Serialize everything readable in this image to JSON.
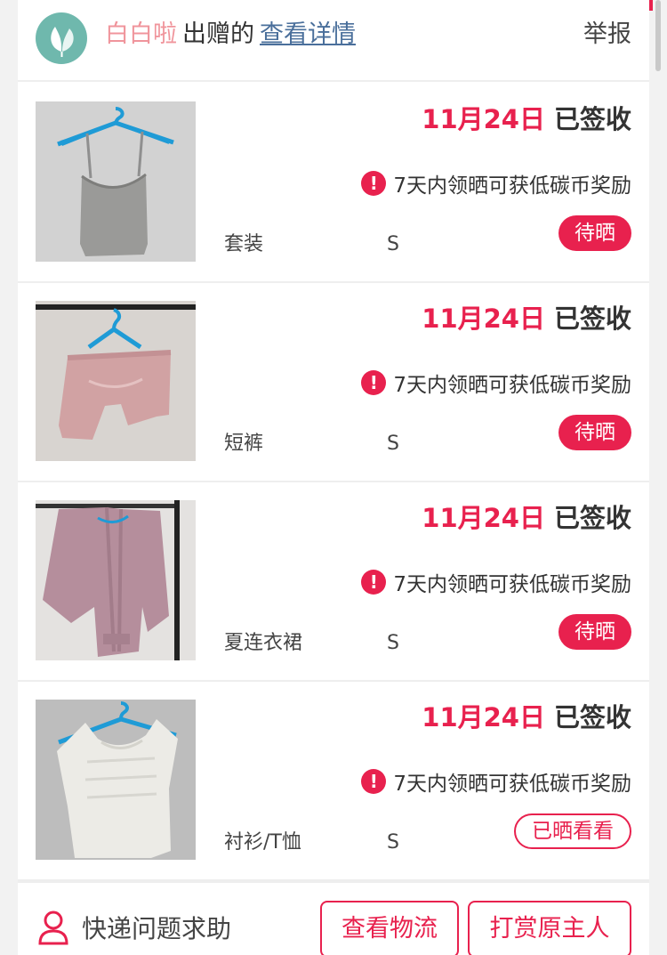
{
  "header": {
    "giver_name": "白白啦",
    "gave_text": "出赠的",
    "details_link": "查看详情",
    "report_label": "举报"
  },
  "items": [
    {
      "date": "11月24日",
      "status": "已签收",
      "hint": "7天内领晒可获低碳币奖励",
      "category": "套装",
      "size": "S",
      "action_label": "待晒",
      "action_style": "filled",
      "image": "grey-camisole-on-blue-hanger"
    },
    {
      "date": "11月24日",
      "status": "已签收",
      "hint": "7天内领晒可获低碳币奖励",
      "category": "短裤",
      "size": "S",
      "action_label": "待晒",
      "action_style": "filled",
      "image": "pink-satin-shorts-on-blue-hanger"
    },
    {
      "date": "11月24日",
      "status": "已签收",
      "hint": "7天内领晒可获低碳币奖励",
      "category": "夏连衣裙",
      "size": "S",
      "action_label": "待晒",
      "action_style": "filled",
      "image": "mauve-satin-robe-on-hanger"
    },
    {
      "date": "11月24日",
      "status": "已签收",
      "hint": "7天内领晒可获低碳币奖励",
      "category": "衬衫/T恤",
      "size": "S",
      "action_label": "已晒看看",
      "action_style": "outline",
      "image": "white-lace-top-on-blue-hanger"
    }
  ],
  "footer": {
    "help_label": "快递问题求助",
    "logistics_button": "查看物流",
    "tip_button": "打赏原主人"
  },
  "colors": {
    "accent": "#e8214e",
    "giver_name": "#f0959c",
    "link": "#4a6f9b",
    "logo_bg": "#6fb8ad"
  }
}
